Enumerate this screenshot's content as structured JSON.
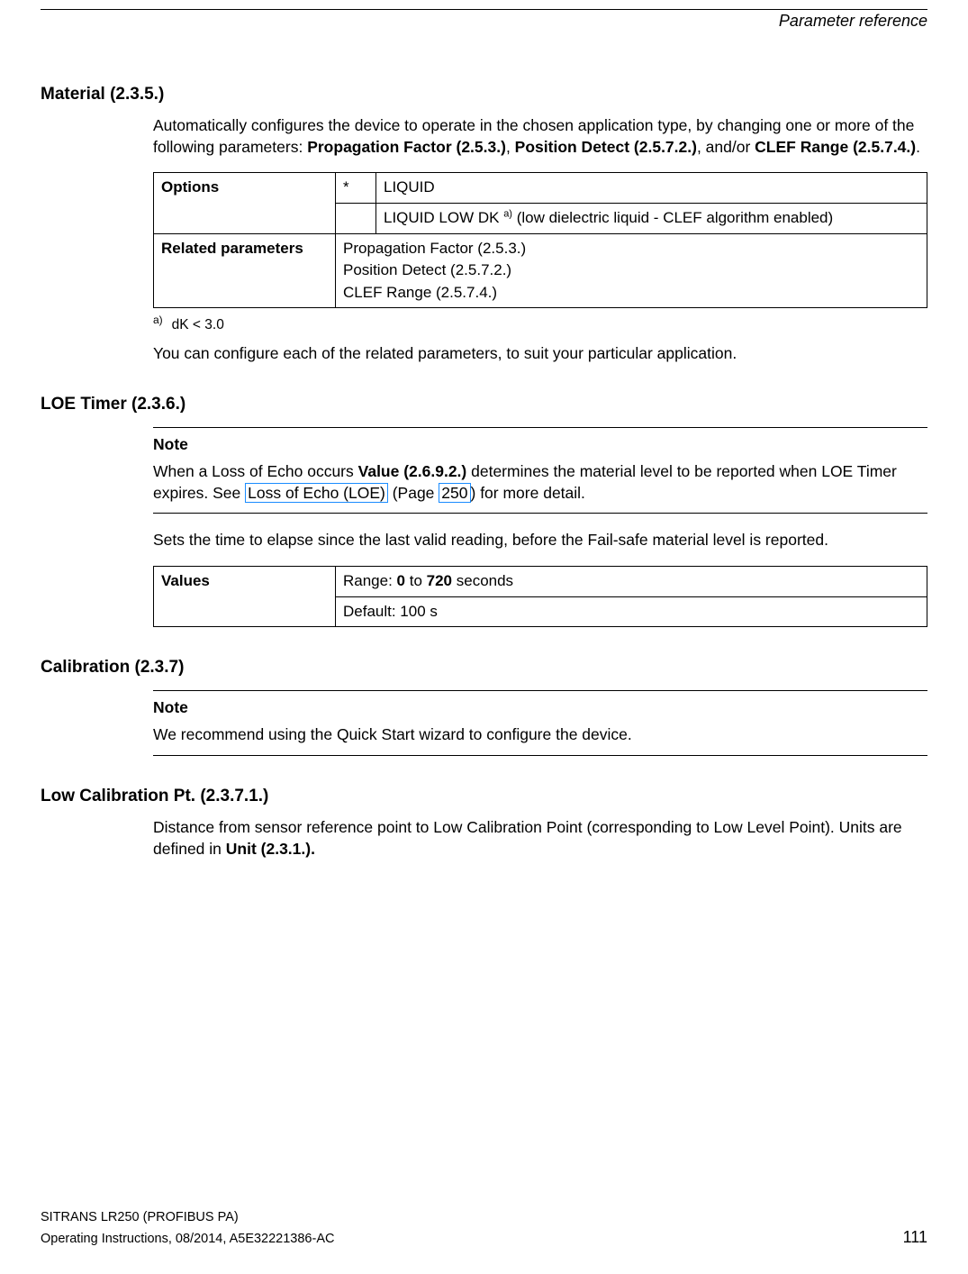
{
  "header": {
    "running": "Parameter reference"
  },
  "sections": {
    "material": {
      "title": "Material (2.3.5.)",
      "intro_pre": "Automatically configures the device to operate in the chosen application type, by changing one or more of the following parameters: ",
      "pf": "Propagation Factor (2.5.3.)",
      "sep1": ", ",
      "pd": "Position Detect (2.5.7.2.)",
      "sep2": ", and/or ",
      "clef": "CLEF Range (2.5.7.4.)",
      "intro_post": ".",
      "table": {
        "options_label": "Options",
        "star": "*",
        "opt1": "LIQUID",
        "opt2_pre": "LIQUID LOW DK ",
        "opt2_sup": "a)",
        "opt2_post": " (low dielectric liquid - CLEF algorithm enabled)",
        "related_label": "Related parameters",
        "rel1": "Propagation Factor (2.5.3.)",
        "rel2": "Position Detect (2.5.7.2.)",
        "rel3": "CLEF Range (2.5.7.4.)"
      },
      "footnote_mark": "a)",
      "footnote_text": "dK < 3.0",
      "closing": " You can configure each of the related parameters, to suit your particular application."
    },
    "loe": {
      "title": "LOE Timer (2.3.6.)",
      "note_title": "Note",
      "note_pre": "When a Loss of Echo occurs ",
      "note_val": "Value (2.6.9.2.)",
      "note_mid": " determines the material level to be reported when LOE Timer expires. See ",
      "link1": "Loss of Echo (LOE)",
      "note_paren_pre": " (Page ",
      "link2": "250",
      "note_paren_post": ") for more detail.",
      "desc": "Sets the time to elapse since the last valid reading, before the Fail-safe material level is reported.",
      "table": {
        "values_label": "Values",
        "range_pre": "Range: ",
        "range_lo": "0",
        "range_mid": " to ",
        "range_hi": "720",
        "range_post": " seconds",
        "default": "Default: 100 s"
      }
    },
    "calibration": {
      "title": "Calibration (2.3.7)",
      "note_title": "Note",
      "note_body": "We recommend using the Quick Start wizard to configure the device."
    },
    "lowcal": {
      "title": "Low Calibration Pt. (2.3.7.1.)",
      "body_pre": "Distance from sensor reference point to Low Calibration Point (corresponding to Low Level Point). Units are defined in ",
      "unit": "Unit (2.3.1.)."
    }
  },
  "footer": {
    "line1": "SITRANS LR250 (PROFIBUS PA)",
    "line2": "Operating Instructions, 08/2014, A5E32221386-AC",
    "page": "111"
  }
}
